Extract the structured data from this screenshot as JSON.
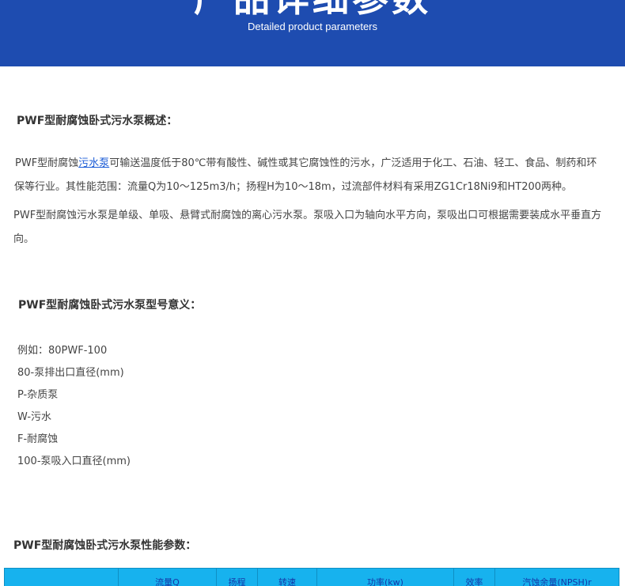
{
  "banner": {
    "title": "产品详细参数",
    "subtitle": "Detailed product parameters"
  },
  "section1": {
    "heading": "PWF型耐腐蚀卧式污水泵概述：",
    "para1_pre": "PWF型耐腐蚀",
    "para1_link": "污水泵",
    "para1_post": "可输送温度低于80℃带有酸性、碱性或其它腐蚀性的污水，广泛适用于化工、石油、轻工、食品、制药和环保等行业。其性能范围：流量Q为10～125m3/h；扬程H为10～18m，过流部件材料有采用ZG1Cr18Ni9和HT200两种。",
    "para2": "PWF型耐腐蚀污水泵是单级、单吸、悬臂式耐腐蚀的离心污水泵。泵吸入口为轴向水平方向，泵吸出口可根据需要装成水平垂直方向。"
  },
  "section2": {
    "heading": "PWF型耐腐蚀卧式污水泵型号意义：",
    "items": [
      "例如：80PWF-100",
      "80-泵排出口直径(mm)",
      "P-杂质泵",
      "W-污水",
      "F-耐腐蚀",
      "100-泵吸入口直径(mm)"
    ]
  },
  "section3": {
    "heading": "PWF型耐腐蚀卧式污水泵性能参数：",
    "table_headers": [
      "",
      "流量Q",
      "扬程",
      "转速",
      "功率(kw)",
      "效率",
      "汽蚀余量(NPSH)r"
    ]
  },
  "colors": {
    "banner_bg": "#1e4cb0",
    "table_header_bg": "#17b2ee",
    "link": "#1a5bd6"
  }
}
